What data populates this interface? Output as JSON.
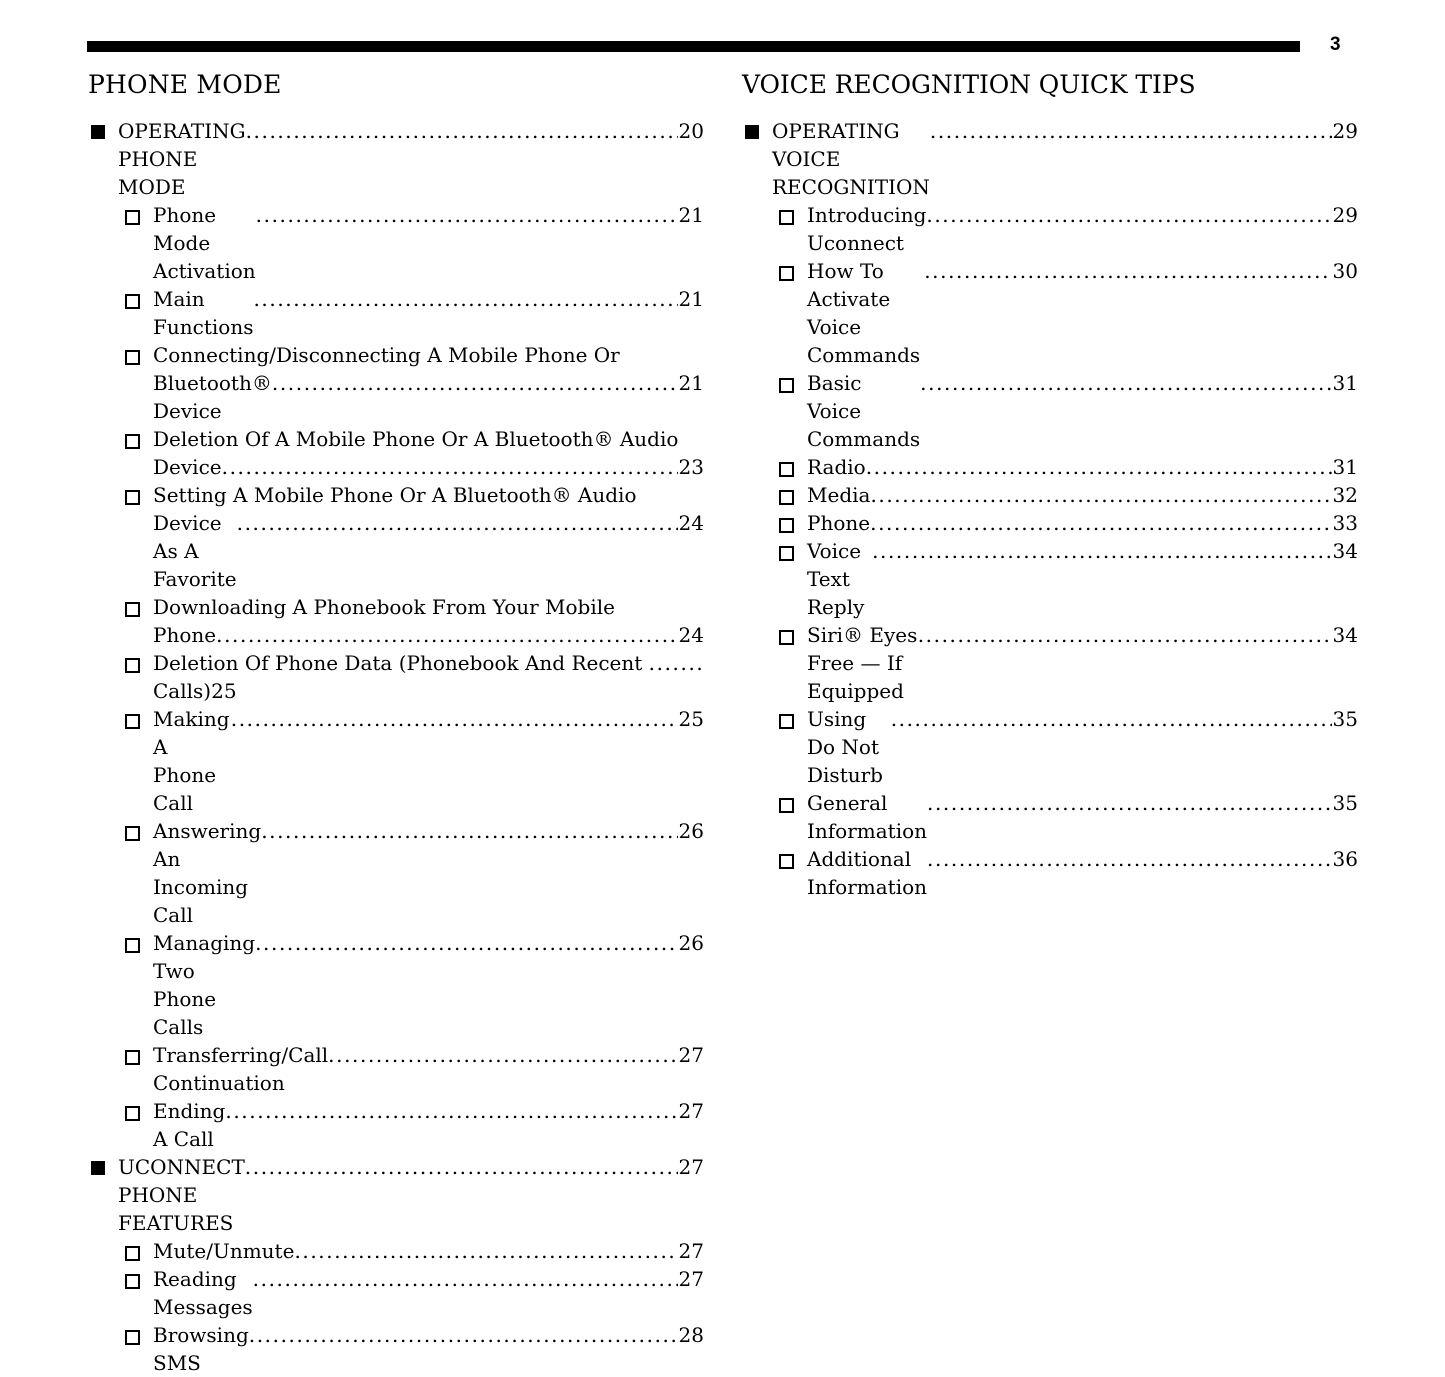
{
  "header": {
    "page_number": "3",
    "rule_color": "#000000"
  },
  "columns": [
    {
      "id": "phone-mode",
      "title": "PHONE MODE",
      "entries": [
        {
          "level": 1,
          "label": "OPERATING PHONE MODE",
          "page": "20"
        },
        {
          "level": 2,
          "label": "Phone Mode Activation",
          "page": "21"
        },
        {
          "level": 2,
          "label": "Main Functions ",
          "page": "21"
        },
        {
          "level": 2,
          "label": "Connecting/Disconnecting A Mobile Phone Or",
          "label2": "Bluetooth® Device",
          "page": "21"
        },
        {
          "level": 2,
          "label": "Deletion Of A Mobile Phone Or A Bluetooth® Audio",
          "label2": "Device",
          "page": "23"
        },
        {
          "level": 2,
          "label": "Setting A Mobile Phone Or A Bluetooth® Audio",
          "label2": "Device As A Favorite ",
          "page": "24"
        },
        {
          "level": 2,
          "label": "Downloading A Phonebook From Your Mobile",
          "label2": "Phone",
          "page": "24"
        },
        {
          "level": 2,
          "variant": "overflow",
          "label": "Deletion Of Phone Data (Phonebook And Recent ",
          "label2": "Calls)",
          "page": "25"
        },
        {
          "level": 2,
          "label": "Making A Phone Call",
          "page": "25"
        },
        {
          "level": 2,
          "label": "Answering An Incoming Call",
          "page": "26"
        },
        {
          "level": 2,
          "label": "Managing Two Phone Calls",
          "page": "26"
        },
        {
          "level": 2,
          "label": "Transferring/Call Continuation",
          "page": "27"
        },
        {
          "level": 2,
          "label": "Ending A Call",
          "page": "27"
        },
        {
          "level": 1,
          "label": "UCONNECT PHONE FEATURES",
          "page": "27"
        },
        {
          "level": 2,
          "label": "Mute/Unmute",
          "page": "27"
        },
        {
          "level": 2,
          "label": "Reading Messages ",
          "page": "27"
        },
        {
          "level": 2,
          "label": "Browsing SMS",
          "page": "28"
        }
      ]
    },
    {
      "id": "voice-recognition-quick-tips",
      "title": "VOICE RECOGNITION QUICK TIPS",
      "entries": [
        {
          "level": 1,
          "label": "OPERATING VOICE RECOGNITION ",
          "page": "29"
        },
        {
          "level": 2,
          "label": "Introducing Uconnect ",
          "page": "29"
        },
        {
          "level": 2,
          "label": "How To Activate Voice Commands ",
          "page": "30"
        },
        {
          "level": 2,
          "label": "Basic Voice Commands",
          "page": "31"
        },
        {
          "level": 2,
          "label": "Radio",
          "page": "31"
        },
        {
          "level": 2,
          "label": "Media",
          "page": "32"
        },
        {
          "level": 2,
          "label": "Phone ",
          "page": "33"
        },
        {
          "level": 2,
          "label": "Voice Text Reply ",
          "page": "34"
        },
        {
          "level": 2,
          "label": "Siri® Eyes Free — If Equipped  ",
          "page": "34"
        },
        {
          "level": 2,
          "label": "Using Do Not Disturb  ",
          "page": "35"
        },
        {
          "level": 2,
          "label": "General Information",
          "page": "35"
        },
        {
          "level": 2,
          "label": "Additional Information",
          "page": "36"
        }
      ]
    }
  ]
}
